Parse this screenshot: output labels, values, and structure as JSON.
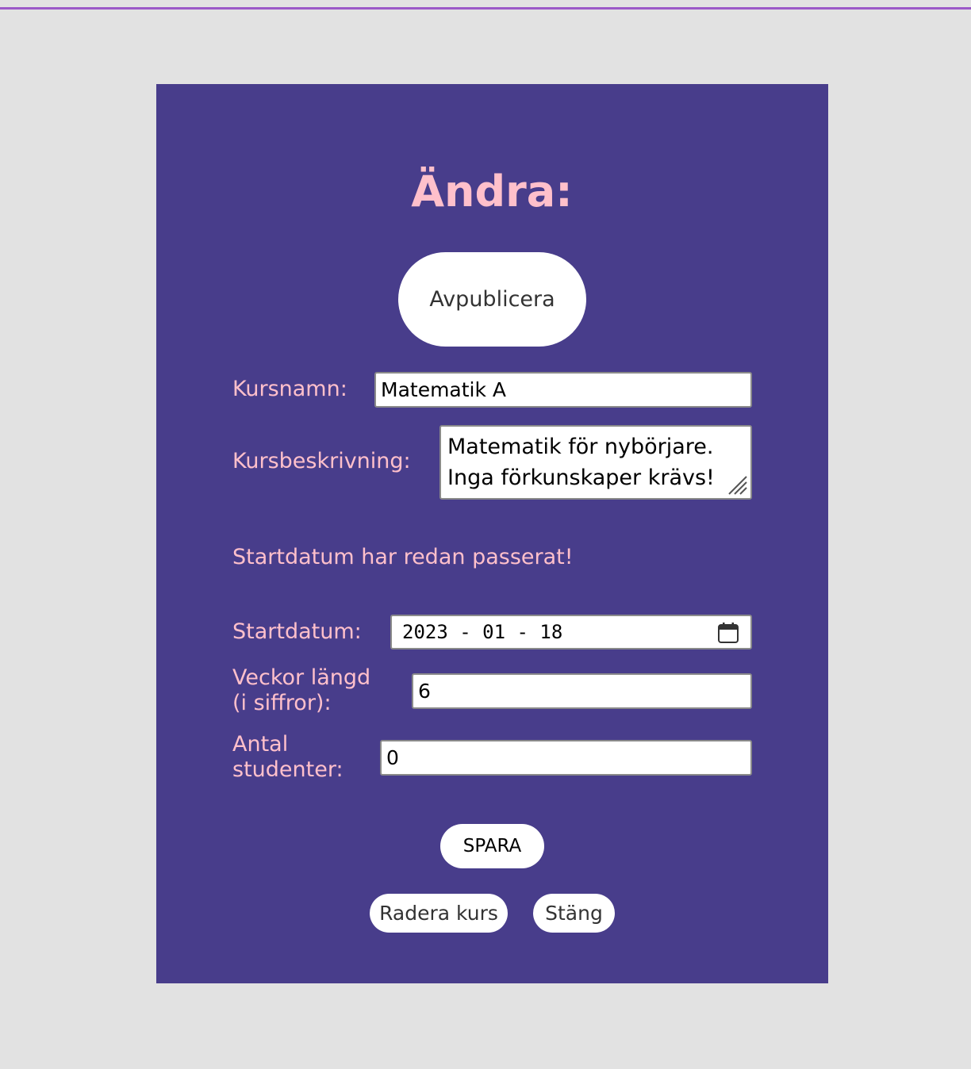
{
  "page": {
    "title": "Ändra:"
  },
  "buttons": {
    "unpublish": "Avpublicera",
    "save": "SPARA",
    "delete": "Radera kurs",
    "close": "Stäng"
  },
  "form": {
    "course_name_label": "Kursnamn:",
    "course_name_value": "Matematik A",
    "description_label": "Kursbeskrivning:",
    "description_value": "Matematik för nybörjare.\nInga förkunskaper krävs!",
    "warning": "Startdatum har redan passerat!",
    "start_date_label": "Startdatum:",
    "start_date_value": "2023 - 01 - 18",
    "weeks_label": "Veckor längd\n(i siffror):",
    "weeks_value": "6",
    "students_label": "Antal\nstudenter:",
    "students_value": "0"
  },
  "colors": {
    "panel_background": "#483d8b",
    "label_text": "#ffc0cb",
    "page_background": "#e2e2e2"
  },
  "icons": {
    "date_picker": "calendar-icon",
    "textarea_resize": "resize-grip-icon"
  }
}
